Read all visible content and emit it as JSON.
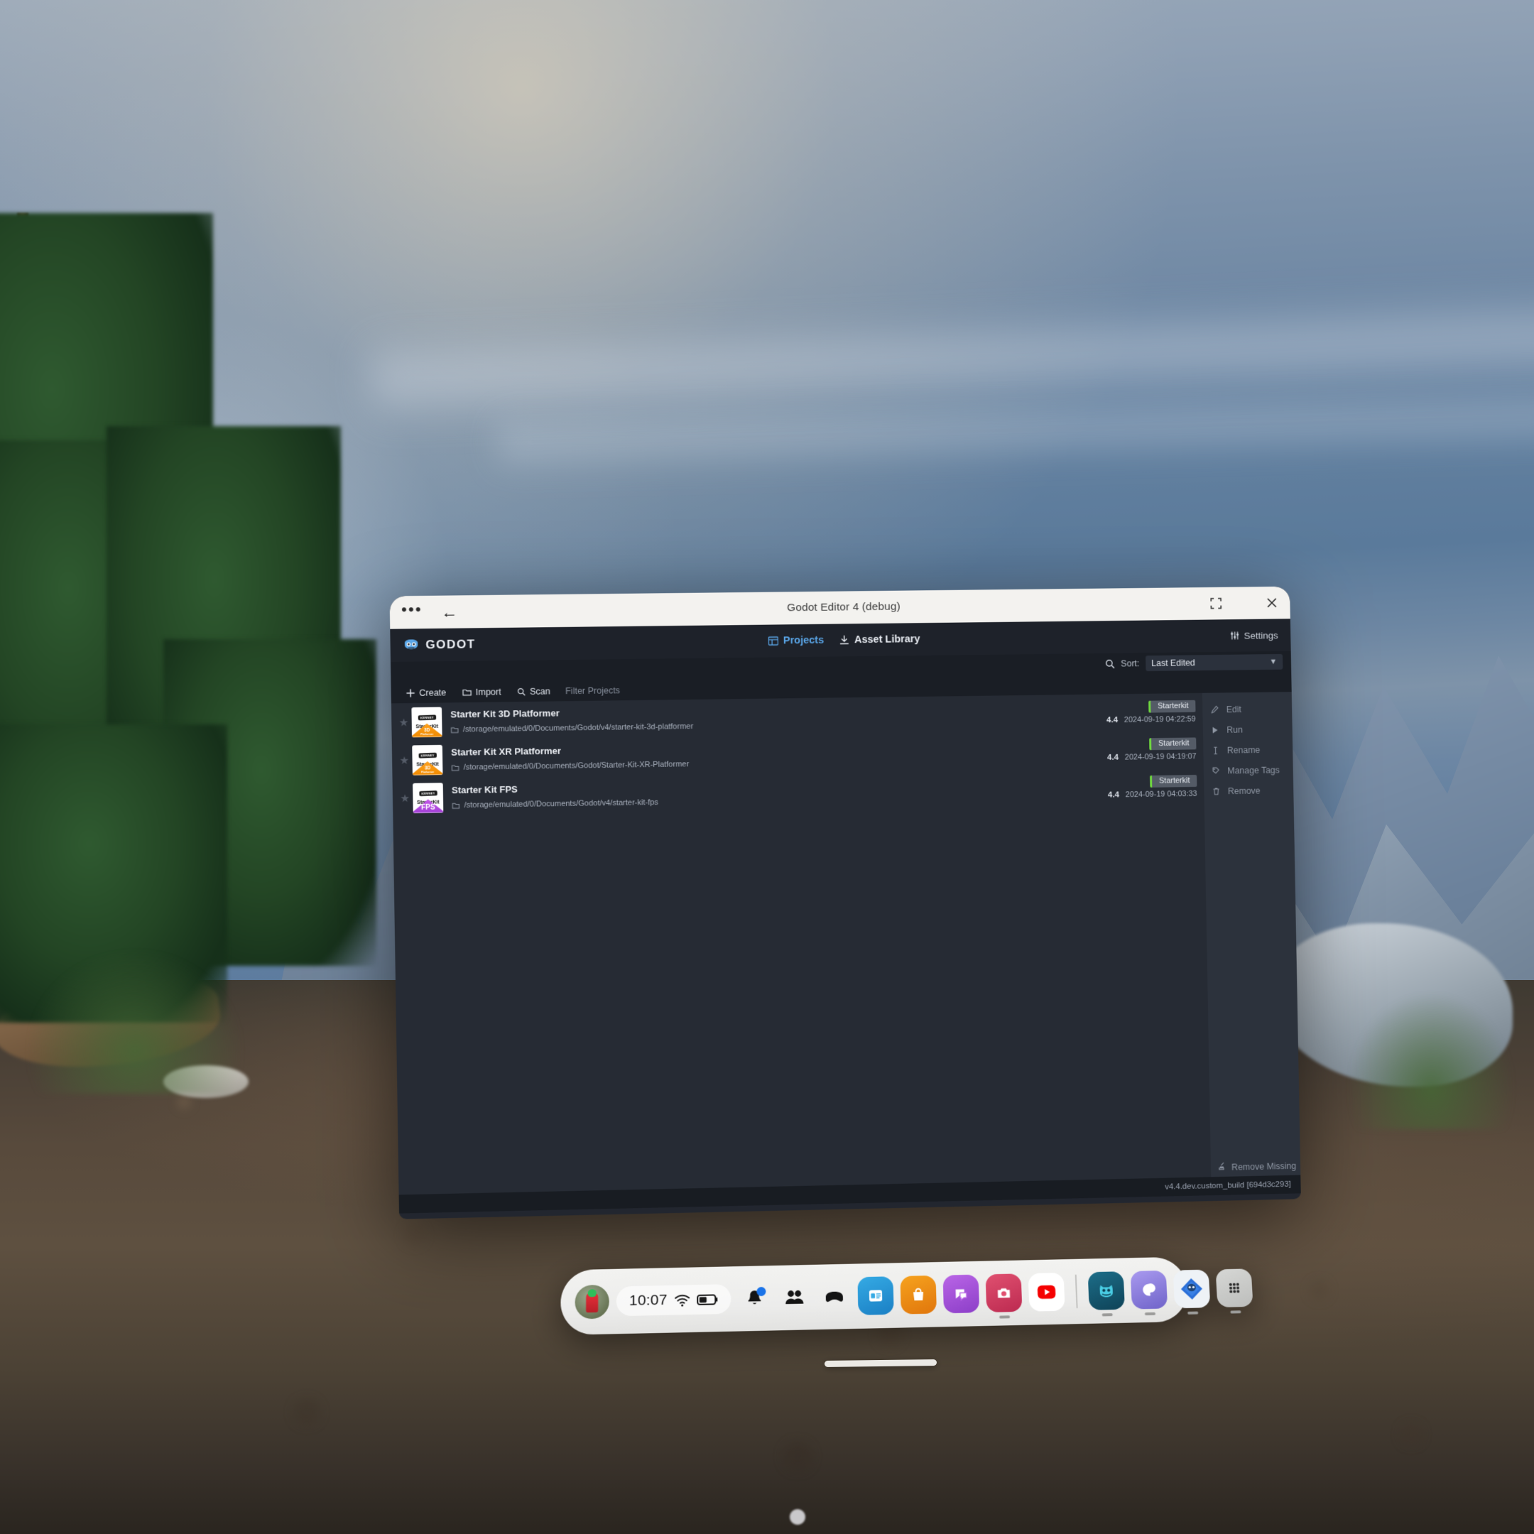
{
  "shell": {
    "title": "Godot Editor 4 (debug)",
    "menu_icon": "more-horizontal-icon",
    "back_icon": "back-arrow-icon",
    "fullscreen_icon": "fullscreen-icon",
    "minimize_icon": "minimize-icon",
    "close_icon": "close-icon"
  },
  "header": {
    "brand": "GODOT",
    "brand_icon": "godot-robot-icon",
    "tabs": [
      {
        "label": "Projects",
        "icon": "grid-icon",
        "active": true
      },
      {
        "label": "Asset Library",
        "icon": "download-icon",
        "active": false
      }
    ],
    "settings": {
      "label": "Settings",
      "icon": "sliders-icon"
    }
  },
  "sort_row": {
    "search_icon": "search-icon",
    "sort_label": "Sort:",
    "sort_value": "Last Edited",
    "chevron_icon": "chevron-down-icon"
  },
  "toolbar": {
    "create": {
      "label": "Create",
      "icon": "plus-icon"
    },
    "import": {
      "label": "Import",
      "icon": "folder-icon"
    },
    "scan": {
      "label": "Scan",
      "icon": "search-icon"
    },
    "filter_placeholder": "Filter Projects",
    "filter_value": ""
  },
  "projects": [
    {
      "name": "Starter Kit 3D Platformer",
      "path": "/storage/emulated/0/Documents/Godot/v4/starter-kit-3d-platformer",
      "tag": "Starterkit",
      "version": "4.4",
      "last_edited": "2024-09-19 04:22:59",
      "favorite": false,
      "icon": {
        "brand": "KENNEY",
        "title": "StarterKit",
        "badge_line1": "3D",
        "badge_line2": "Platformer",
        "badge_color": "#f59400",
        "kind": "platformer"
      }
    },
    {
      "name": "Starter Kit XR Platformer",
      "path": "/storage/emulated/0/Documents/Godot/Starter-Kit-XR-Platformer",
      "tag": "Starterkit",
      "version": "4.4",
      "last_edited": "2024-09-19 04:19:07",
      "favorite": false,
      "icon": {
        "brand": "KENNEY",
        "title": "StarterKit",
        "badge_line1": "3D",
        "badge_line2": "Platformer",
        "badge_color": "#f59400",
        "kind": "platformer"
      }
    },
    {
      "name": "Starter Kit FPS",
      "path": "/storage/emulated/0/Documents/Godot/v4/starter-kit-fps",
      "tag": "Starterkit",
      "version": "4.4",
      "last_edited": "2024-09-19 04:03:33",
      "favorite": false,
      "icon": {
        "brand": "KENNEY",
        "title": "StarterKit",
        "badge_line1": "FPS",
        "badge_line2": "",
        "badge_color": "#b94fe0",
        "kind": "fps"
      }
    }
  ],
  "side_actions": [
    {
      "label": "Edit",
      "icon": "pencil-icon"
    },
    {
      "label": "Run",
      "icon": "play-icon"
    },
    {
      "label": "Rename",
      "icon": "text-cursor-icon"
    },
    {
      "label": "Manage Tags",
      "icon": "tag-icon"
    },
    {
      "label": "Remove",
      "icon": "trash-icon"
    }
  ],
  "remove_missing": {
    "label": "Remove Missing",
    "icon": "broom-icon"
  },
  "status": {
    "version": "v4.4.dev.custom_build [694d3c293]"
  },
  "taskbar": {
    "avatar_name": "user-avatar",
    "clock": "10:07",
    "wifi_icon": "wifi-icon",
    "battery_icon": "battery-icon",
    "quick_items": [
      {
        "name": "notifications-button",
        "icon": "bell-icon",
        "badge": true
      },
      {
        "name": "people-button",
        "icon": "people-icon",
        "badge": false
      },
      {
        "name": "headset-button",
        "icon": "headset-icon",
        "badge": false
      }
    ],
    "apps": [
      {
        "name": "browser-app",
        "icon": "browser-icon",
        "color": "#2396d8",
        "running": false
      },
      {
        "name": "store-app",
        "icon": "shopping-bag-icon",
        "color": "#ec8a15",
        "running": false
      },
      {
        "name": "messages-app",
        "icon": "chat-bubble-icon",
        "color": "#a94fd8",
        "running": false
      },
      {
        "name": "camera-app",
        "icon": "camera-icon",
        "color": "#cf3a5e",
        "running": true
      },
      {
        "name": "youtube-app",
        "icon": "youtube-icon",
        "color": "#ffffff",
        "running": false
      }
    ],
    "pinned": [
      {
        "name": "cat-app",
        "icon": "cat-icon",
        "color": "#17586e",
        "running": true
      },
      {
        "name": "paint-app",
        "icon": "palette-icon",
        "color": "#8a7ddd",
        "running": true
      },
      {
        "name": "godot-app",
        "icon": "godot-diamond-icon",
        "color": "#e9eef3",
        "running": true
      },
      {
        "name": "all-apps",
        "icon": "app-grid-icon",
        "color": "#c8c9c7",
        "running": true
      }
    ]
  }
}
